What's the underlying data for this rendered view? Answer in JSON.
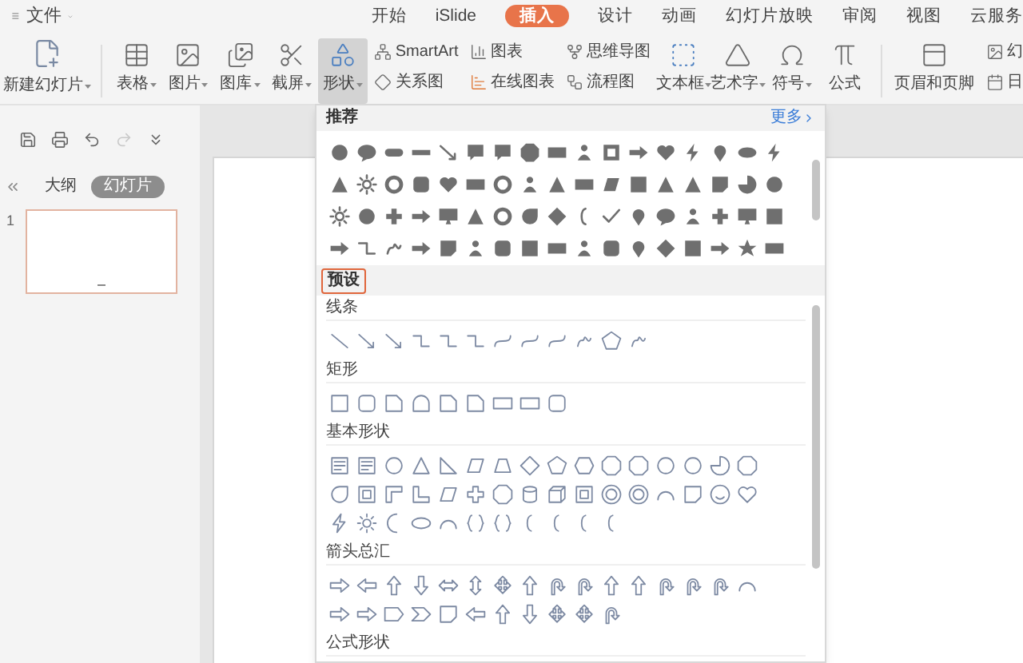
{
  "menu_bar": {
    "file_menu": "文件"
  },
  "tabs": [
    {
      "label": "开始",
      "selected": false
    },
    {
      "label": "iSlide",
      "selected": false
    },
    {
      "label": "插入",
      "selected": true
    },
    {
      "label": "设计",
      "selected": false
    },
    {
      "label": "动画",
      "selected": false
    },
    {
      "label": "幻灯片放映",
      "selected": false
    },
    {
      "label": "审阅",
      "selected": false
    },
    {
      "label": "视图",
      "selected": false
    },
    {
      "label": "云服务",
      "selected": false
    }
  ],
  "ribbon": {
    "new_slide": {
      "label": "新建幻灯片",
      "dropdown": true
    },
    "media_buttons": [
      {
        "label": "表格",
        "dropdown": true,
        "selected": false
      },
      {
        "label": "图片",
        "dropdown": true,
        "selected": false
      },
      {
        "label": "图库",
        "dropdown": true,
        "selected": false
      },
      {
        "label": "截屏",
        "dropdown": true,
        "selected": false
      },
      {
        "label": "形状",
        "dropdown": true,
        "selected": true
      }
    ],
    "small_columns": [
      [
        "SmartArt",
        "关系图"
      ],
      [
        "图表",
        "在线图表"
      ],
      [
        "思维导图",
        "流程图"
      ]
    ],
    "text_buttons": [
      {
        "label": "文本框",
        "dropdown": true
      },
      {
        "label": "艺术字",
        "dropdown": true
      },
      {
        "label": "符号",
        "dropdown": true
      },
      {
        "label": "公式",
        "dropdown": false
      }
    ],
    "header_footer": "页眉和页脚",
    "cut_column": [
      "幻",
      "日"
    ]
  },
  "quick_access": [
    {
      "disabled": false
    },
    {
      "disabled": false
    },
    {
      "disabled": false
    },
    {
      "disabled": true
    },
    {
      "disabled": false
    }
  ],
  "side_panel": {
    "tabs": [
      {
        "label": "大纲",
        "selected": false
      },
      {
        "label": "幻灯片",
        "selected": true
      }
    ],
    "slides": [
      {
        "number": "1",
        "selected": true
      }
    ]
  },
  "shapes_panel": {
    "title": "推荐",
    "more": "更多",
    "recommended": {
      "rows": [
        [
          {
            "kind": "circle"
          },
          {
            "kind": "bubble"
          },
          {
            "kind": "pill"
          },
          {
            "kind": "bar"
          },
          {
            "kind": "arrow-line"
          },
          {
            "kind": "callout"
          },
          {
            "kind": "callout"
          },
          {
            "kind": "octagon"
          },
          {
            "kind": "rect"
          },
          {
            "kind": "person"
          },
          {
            "kind": "frame"
          },
          {
            "kind": "arrow-right"
          },
          {
            "kind": "heart"
          },
          {
            "kind": "bolt"
          },
          {
            "kind": "pin"
          },
          {
            "kind": "oval"
          },
          {
            "kind": "bolt"
          }
        ],
        [
          {
            "kind": "triangle"
          },
          {
            "kind": "sun"
          },
          {
            "kind": "ring"
          },
          {
            "kind": "rounded"
          },
          {
            "kind": "heart"
          },
          {
            "kind": "rect"
          },
          {
            "kind": "ring"
          },
          {
            "kind": "person"
          },
          {
            "kind": "triangle"
          },
          {
            "kind": "rect"
          },
          {
            "kind": "parallelogram"
          },
          {
            "kind": "square"
          },
          {
            "kind": "triangle"
          },
          {
            "kind": "triangle"
          },
          {
            "kind": "doc"
          },
          {
            "kind": "pie"
          },
          {
            "kind": "circle"
          }
        ],
        [
          {
            "kind": "sun"
          },
          {
            "kind": "circle"
          },
          {
            "kind": "plus"
          },
          {
            "kind": "arrow-right"
          },
          {
            "kind": "monitor"
          },
          {
            "kind": "triangle"
          },
          {
            "kind": "ring"
          },
          {
            "kind": "teardrop"
          },
          {
            "kind": "diamond"
          },
          {
            "kind": "bracket"
          },
          {
            "kind": "check"
          },
          {
            "kind": "pin"
          },
          {
            "kind": "bubble"
          },
          {
            "kind": "person"
          },
          {
            "kind": "plus"
          },
          {
            "kind": "monitor"
          },
          {
            "kind": "textbox"
          }
        ],
        [
          {
            "kind": "arrow-right"
          },
          {
            "kind": "elbow"
          },
          {
            "kind": "scribble"
          },
          {
            "kind": "arrow-right"
          },
          {
            "kind": "doc"
          },
          {
            "kind": "person"
          },
          {
            "kind": "rounded"
          },
          {
            "kind": "square"
          },
          {
            "kind": "rect"
          },
          {
            "kind": "person"
          },
          {
            "kind": "rounded"
          },
          {
            "kind": "pin"
          },
          {
            "kind": "diamond"
          },
          {
            "kind": "textbox"
          },
          {
            "kind": "arrow-right"
          },
          {
            "kind": "star"
          },
          {
            "kind": "rect"
          }
        ]
      ]
    },
    "presets": {
      "label": "预设",
      "selected": true,
      "sections": [
        {
          "title": "线条",
          "rows": [
            [
              {
                "kind": "line"
              },
              {
                "kind": "arrow-line"
              },
              {
                "kind": "arrow-line"
              },
              {
                "kind": "elbow"
              },
              {
                "kind": "elbow"
              },
              {
                "kind": "elbow"
              },
              {
                "kind": "curve"
              },
              {
                "kind": "curve"
              },
              {
                "kind": "curve"
              },
              {
                "kind": "scribble"
              },
              {
                "kind": "pentagon"
              },
              {
                "kind": "scribble"
              }
            ]
          ]
        },
        {
          "title": "矩形",
          "rows": [
            [
              {
                "kind": "square"
              },
              {
                "kind": "rounded"
              },
              {
                "kind": "snip"
              },
              {
                "kind": "round-top"
              },
              {
                "kind": "snip"
              },
              {
                "kind": "snip"
              },
              {
                "kind": "rect"
              },
              {
                "kind": "rect"
              },
              {
                "kind": "rounded"
              }
            ]
          ]
        },
        {
          "title": "基本形状",
          "rows": [
            [
              {
                "kind": "textbox"
              },
              {
                "kind": "textbox"
              },
              {
                "kind": "circle"
              },
              {
                "kind": "triangle"
              },
              {
                "kind": "right-triangle"
              },
              {
                "kind": "parallelogram"
              },
              {
                "kind": "trapezoid"
              },
              {
                "kind": "diamond"
              },
              {
                "kind": "pentagon"
              },
              {
                "kind": "hexagon"
              },
              {
                "kind": "octagon"
              },
              {
                "kind": "octagon"
              },
              {
                "kind": "circle"
              },
              {
                "kind": "circle"
              },
              {
                "kind": "pie"
              },
              {
                "kind": "octagon"
              }
            ],
            [
              {
                "kind": "teardrop"
              },
              {
                "kind": "frame"
              },
              {
                "kind": "corner"
              },
              {
                "kind": "lshape"
              },
              {
                "kind": "parallelogram"
              },
              {
                "kind": "plus"
              },
              {
                "kind": "octagon"
              },
              {
                "kind": "can"
              },
              {
                "kind": "cube"
              },
              {
                "kind": "frame"
              },
              {
                "kind": "ring"
              },
              {
                "kind": "ring"
              },
              {
                "kind": "arc"
              },
              {
                "kind": "doc"
              },
              {
                "kind": "smile"
              },
              {
                "kind": "heart"
              }
            ],
            [
              {
                "kind": "bolt"
              },
              {
                "kind": "sun"
              },
              {
                "kind": "moon"
              },
              {
                "kind": "oval"
              },
              {
                "kind": "arc"
              },
              {
                "kind": "brace"
              },
              {
                "kind": "brace"
              },
              {
                "kind": "bracket"
              },
              {
                "kind": "bracket"
              },
              {
                "kind": "bracket"
              },
              {
                "kind": "bracket"
              }
            ]
          ]
        },
        {
          "title": "箭头总汇",
          "rows": [
            [
              {
                "kind": "arrow-right"
              },
              {
                "kind": "arrow-left"
              },
              {
                "kind": "arrow-up"
              },
              {
                "kind": "arrow-down"
              },
              {
                "kind": "arrow-lr"
              },
              {
                "kind": "arrow-ud"
              },
              {
                "kind": "quad-arrow"
              },
              {
                "kind": "arrow-up"
              },
              {
                "kind": "uturn"
              },
              {
                "kind": "uturn"
              },
              {
                "kind": "arrow-up"
              },
              {
                "kind": "arrow-up"
              },
              {
                "kind": "uturn"
              },
              {
                "kind": "uturn"
              },
              {
                "kind": "uturn"
              },
              {
                "kind": "arc"
              }
            ],
            [
              {
                "kind": "arrow-right"
              },
              {
                "kind": "arrow-right"
              },
              {
                "kind": "home-plate"
              },
              {
                "kind": "chevron"
              },
              {
                "kind": "doc"
              },
              {
                "kind": "arrow-left"
              },
              {
                "kind": "arrow-up"
              },
              {
                "kind": "arrow-down"
              },
              {
                "kind": "quad-arrow"
              },
              {
                "kind": "quad-arrow"
              },
              {
                "kind": "uturn"
              }
            ]
          ]
        },
        {
          "title": "公式形状"
        }
      ]
    }
  }
}
